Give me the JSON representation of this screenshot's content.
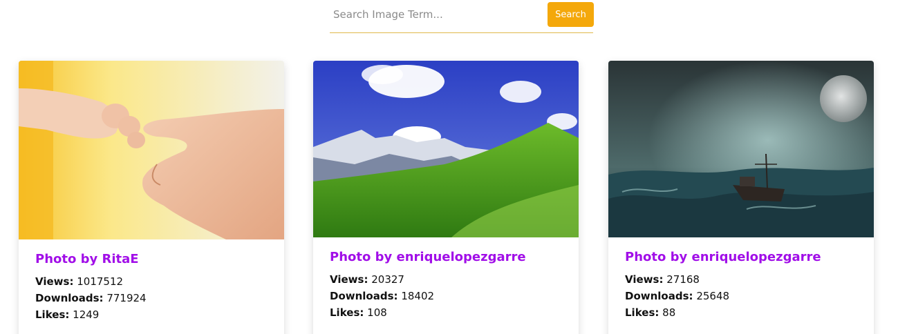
{
  "search": {
    "placeholder": "Search Image Term...",
    "value": "",
    "button_label": "Search"
  },
  "colors": {
    "accent": "#f4a80b",
    "title": "#a10ee8"
  },
  "labels": {
    "views": "Views:",
    "downloads": "Downloads:",
    "likes": "Likes:"
  },
  "cards": [
    {
      "image": "baby-hand-holding-adult-finger-photo",
      "title": "Photo by RitaE",
      "views": "1017512",
      "downloads": "771924",
      "likes": "1249"
    },
    {
      "image": "green-alpine-meadow-mountains-photo",
      "title": "Photo by enriquelopezgarre",
      "views": "20327",
      "downloads": "18402",
      "likes": "108"
    },
    {
      "image": "ship-stormy-sea-moon-photo",
      "title": "Photo by enriquelopezgarre",
      "views": "27168",
      "downloads": "25648",
      "likes": "88"
    }
  ]
}
